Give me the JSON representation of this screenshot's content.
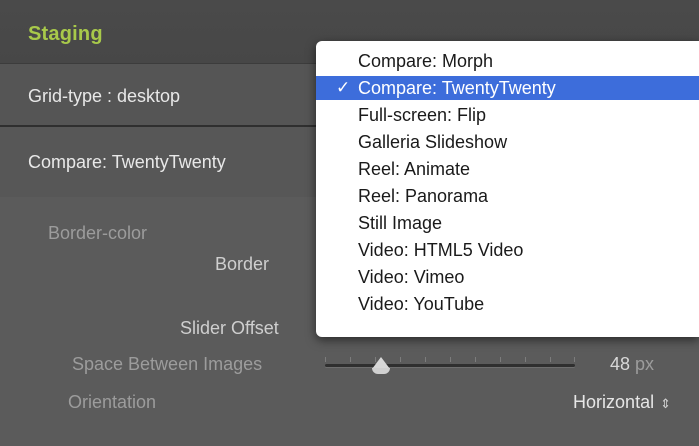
{
  "header": {
    "title": "Staging"
  },
  "grid_type": {
    "label": "Grid-type : desktop"
  },
  "compare": {
    "label": "Compare: TwentyTwenty"
  },
  "fields": {
    "border_color": "Border-color",
    "border": "Border",
    "slider_offset": "Slider Offset",
    "space_between": "Space Between Images",
    "orientation": "Orientation"
  },
  "border_color_value": "#f2f2f2",
  "space_between_value": {
    "number": "48",
    "unit": " px",
    "slider_fraction": 0.22
  },
  "orientation_value": "Horizontal",
  "dropdown": {
    "checkmark": "✓",
    "items": [
      "Compare: Morph",
      "Compare: TwentyTwenty",
      "Full-screen: Flip",
      "Galleria Slideshow",
      "Reel: Animate",
      "Reel: Panorama",
      "Still Image",
      "Video: HTML5 Video",
      "Video: Vimeo",
      "Video: YouTube"
    ],
    "selected_index": 1,
    "highlight_color": "#3d6ddb"
  }
}
